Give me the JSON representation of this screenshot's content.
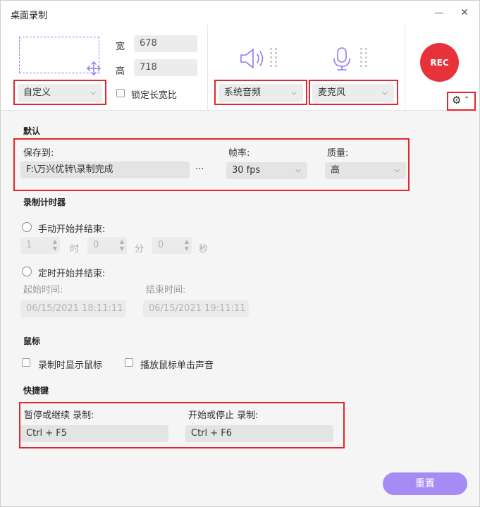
{
  "window": {
    "title": "桌面录制",
    "minimize_glyph": "—",
    "close_glyph": "✕"
  },
  "capture": {
    "width_label": "宽",
    "width_value": "678",
    "height_label": "高",
    "height_value": "718",
    "preset": "自定义",
    "lock_ratio_label": "锁定长宽比",
    "lock_ratio_checked": false
  },
  "audio": {
    "system_audio": "系统音频",
    "microphone": "麦克风"
  },
  "rec": {
    "label": "REC",
    "color": "#e8323a"
  },
  "defaults": {
    "section_title": "默认",
    "save_to_label": "保存到:",
    "save_path": "F:\\万兴优转\\录制完成",
    "browse_glyph": "···",
    "framerate_label": "帧率:",
    "framerate_value": "30 fps",
    "quality_label": "质量:",
    "quality_value": "高"
  },
  "timer": {
    "section_title": "录制计时器",
    "manual_label": "手动开始并结束:",
    "hours_value": "1",
    "hours_unit": "时",
    "minutes_value": "0",
    "minutes_unit": "分",
    "seconds_value": "0",
    "seconds_unit": "秒",
    "scheduled_label": "定时开始并结束:",
    "start_label": "起始时间:",
    "start_value": "06/15/2021 18:11:11",
    "end_label": "结束时间:",
    "end_value": "06/15/2021 19:11:11"
  },
  "mouse": {
    "section_title": "鼠标",
    "show_cursor_label": "录制时显示鼠标",
    "click_sound_label": "播放鼠标单击声音"
  },
  "hotkeys": {
    "section_title": "快捷键",
    "pause_label": "暂停或继续 录制:",
    "pause_value": "Ctrl + F5",
    "startstop_label": "开始或停止 录制:",
    "startstop_value": "Ctrl + F6"
  },
  "footer": {
    "reset_label": "重置",
    "accent": "#a78bf5"
  },
  "highlight_color": "#e5252a"
}
